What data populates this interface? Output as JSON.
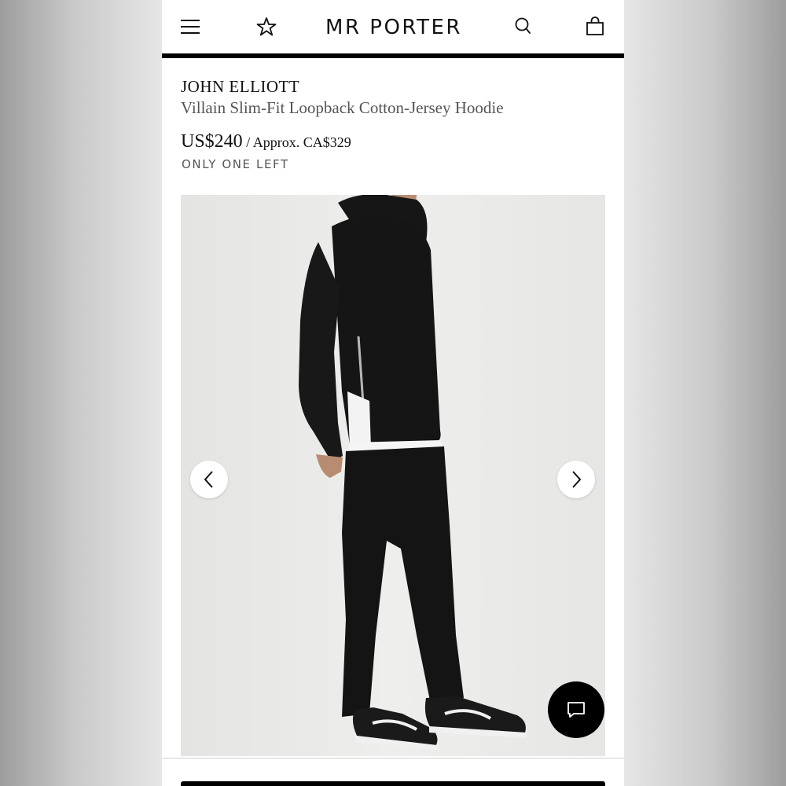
{
  "header": {
    "logo_text": "MR PORTER",
    "menu_icon": "hamburger-menu-icon",
    "wishlist_icon": "star-icon",
    "search_icon": "search-icon",
    "bag_icon": "shopping-bag-icon"
  },
  "product": {
    "brand": "JOHN ELLIOTT",
    "name": "Villain Slim-Fit Loopback Cotton-Jersey Hoodie",
    "price": "US$240",
    "approx_price": " / Approx. CA$329",
    "stock_status": "ONLY ONE LEFT"
  },
  "gallery": {
    "prev_icon": "chevron-left-icon",
    "next_icon": "chevron-right-icon"
  },
  "chat": {
    "icon": "chat-bubble-icon"
  },
  "colors": {
    "text_primary": "#111111",
    "text_secondary": "#555555",
    "accent": "#000000",
    "background": "#ffffff"
  }
}
